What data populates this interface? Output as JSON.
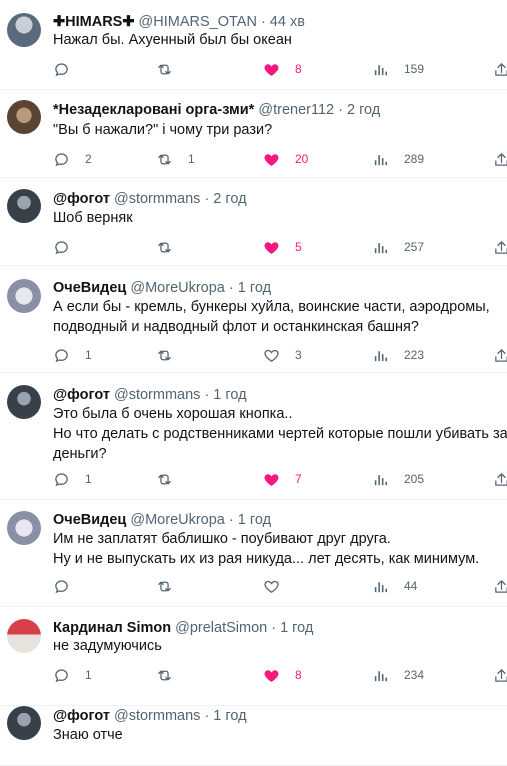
{
  "colors": {
    "like": "#f91880",
    "muted": "#536471",
    "text": "#0f1419",
    "divider": "#eff3f4"
  },
  "tweets": [
    {
      "name": "✚HIMARS✚",
      "handle": "@HIMARS_OTAN",
      "time": "· 44 хв",
      "lines": [
        "Нажал бы. Ахуенный был бы океан"
      ],
      "replies": "",
      "retweets": "",
      "likes": "8",
      "views": "159",
      "liked": true
    },
    {
      "name": "*Незадекларовані орга-зми*",
      "handle": "@trener112",
      "time": "· 2 год",
      "lines": [
        "\"Вы б нажали?\" і чому три рази?"
      ],
      "replies": "2",
      "retweets": "1",
      "likes": "20",
      "views": "289",
      "liked": true
    },
    {
      "name": "@фогот",
      "handle": "@stormmans",
      "time": "· 2 год",
      "lines": [
        "Шоб верняк"
      ],
      "replies": "",
      "retweets": "",
      "likes": "5",
      "views": "257",
      "liked": true
    },
    {
      "name": "ОчеВидец",
      "handle": "@MoreUkropa",
      "time": "· 1 год",
      "lines": [
        "А если бы - кремль, бункеры хуйла, воинские части, аэродромы,",
        "подводный и надводный флот и останкинская башня?"
      ],
      "replies": "1",
      "retweets": "",
      "likes": "3",
      "views": "223",
      "liked": false
    },
    {
      "name": "@фогот",
      "handle": "@stormmans",
      "time": "· 1 год",
      "lines": [
        "Это была б очень хорошая кнопка..",
        "Но что делать с родственниками чертей которые пошли убивать за",
        "деньги?"
      ],
      "replies": "1",
      "retweets": "",
      "likes": "7",
      "views": "205",
      "liked": true
    },
    {
      "name": "ОчеВидец",
      "handle": "@MoreUkropa",
      "time": "· 1 год",
      "lines": [
        "Им не заплатят баблишко - поубивают друг друга.",
        "Ну и не выпускать их из рая никуда... лет десять, как минимум."
      ],
      "replies": "",
      "retweets": "",
      "likes": "",
      "views": "44",
      "liked": false
    },
    {
      "name": "Кардинал Simon",
      "handle": "@prelatSimon",
      "time": "· 1 год",
      "lines": [
        "не задумуючись"
      ],
      "replies": "1",
      "retweets": "",
      "likes": "8",
      "views": "234",
      "liked": true
    },
    {
      "name": "@фогот",
      "handle": "@stormmans",
      "time": "· 1 год",
      "lines": [
        "Знаю отче"
      ],
      "replies": "",
      "retweets": "",
      "likes": "",
      "views": "",
      "liked": false
    }
  ]
}
